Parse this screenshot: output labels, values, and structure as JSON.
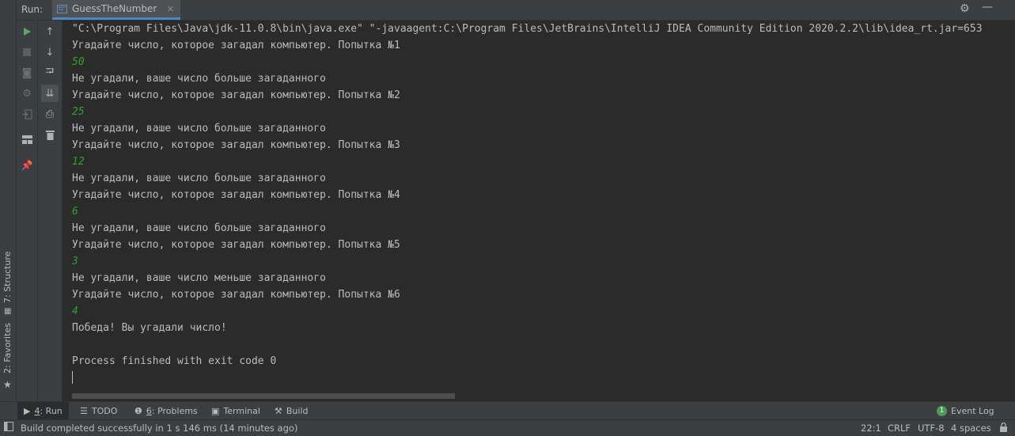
{
  "header": {
    "run_label": "Run:",
    "tab_title": "GuessTheNumber",
    "tab_close": "×",
    "settings_icon": "gear-icon",
    "minimize_icon": "minimize-icon"
  },
  "left_stripe": {
    "structure_label": "7: Structure",
    "favorites_label": "2: Favorites"
  },
  "console": {
    "lines": [
      {
        "text": "\"C:\\Program Files\\Java\\jdk-11.0.8\\bin\\java.exe\" \"-javaagent:C:\\Program Files\\JetBrains\\IntelliJ IDEA Community Edition 2020.2.2\\lib\\idea_rt.jar=653",
        "type": "output"
      },
      {
        "text": "Угадайте число, которое загадал компьютер. Попытка №1",
        "type": "output"
      },
      {
        "text": "50",
        "type": "user"
      },
      {
        "text": "Не угадали, ваше число больше загаданного",
        "type": "output"
      },
      {
        "text": "Угадайте число, которое загадал компьютер. Попытка №2",
        "type": "output"
      },
      {
        "text": "25",
        "type": "user"
      },
      {
        "text": "Не угадали, ваше число больше загаданного",
        "type": "output"
      },
      {
        "text": "Угадайте число, которое загадал компьютер. Попытка №3",
        "type": "output"
      },
      {
        "text": "12",
        "type": "user"
      },
      {
        "text": "Не угадали, ваше число больше загаданного",
        "type": "output"
      },
      {
        "text": "Угадайте число, которое загадал компьютер. Попытка №4",
        "type": "output"
      },
      {
        "text": "6",
        "type": "user"
      },
      {
        "text": "Не угадали, ваше число больше загаданного",
        "type": "output"
      },
      {
        "text": "Угадайте число, которое загадал компьютер. Попытка №5",
        "type": "output"
      },
      {
        "text": "3",
        "type": "user"
      },
      {
        "text": "Не угадали, ваше число меньше загаданного",
        "type": "output"
      },
      {
        "text": "Угадайте число, которое загадал компьютер. Попытка №6",
        "type": "output"
      },
      {
        "text": "4",
        "type": "user"
      },
      {
        "text": "Победа! Вы угадали число!",
        "type": "output"
      },
      {
        "text": "",
        "type": "output"
      },
      {
        "text": "Process finished with exit code 0",
        "type": "output"
      }
    ]
  },
  "tool_tabs": {
    "run": {
      "mnemonic": "4",
      "label": ": Run"
    },
    "todo": {
      "label": "TODO"
    },
    "problems": {
      "mnemonic": "6",
      "label": ": Problems"
    },
    "terminal": {
      "label": "Terminal"
    },
    "build": {
      "label": "Build"
    },
    "event_log": {
      "badge": "1",
      "label": "Event Log"
    }
  },
  "status_bar": {
    "message": "Build completed successfully in 1 s 146 ms (14 minutes ago)",
    "position": "22:1",
    "line_separator": "CRLF",
    "encoding": "UTF-8",
    "indent": "4 spaces"
  },
  "colors": {
    "background": "#2b2b2b",
    "panel": "#3c3f41",
    "user_input": "#2fa02f",
    "run_green": "#59a869",
    "accent_blue": "#4a88c7"
  }
}
